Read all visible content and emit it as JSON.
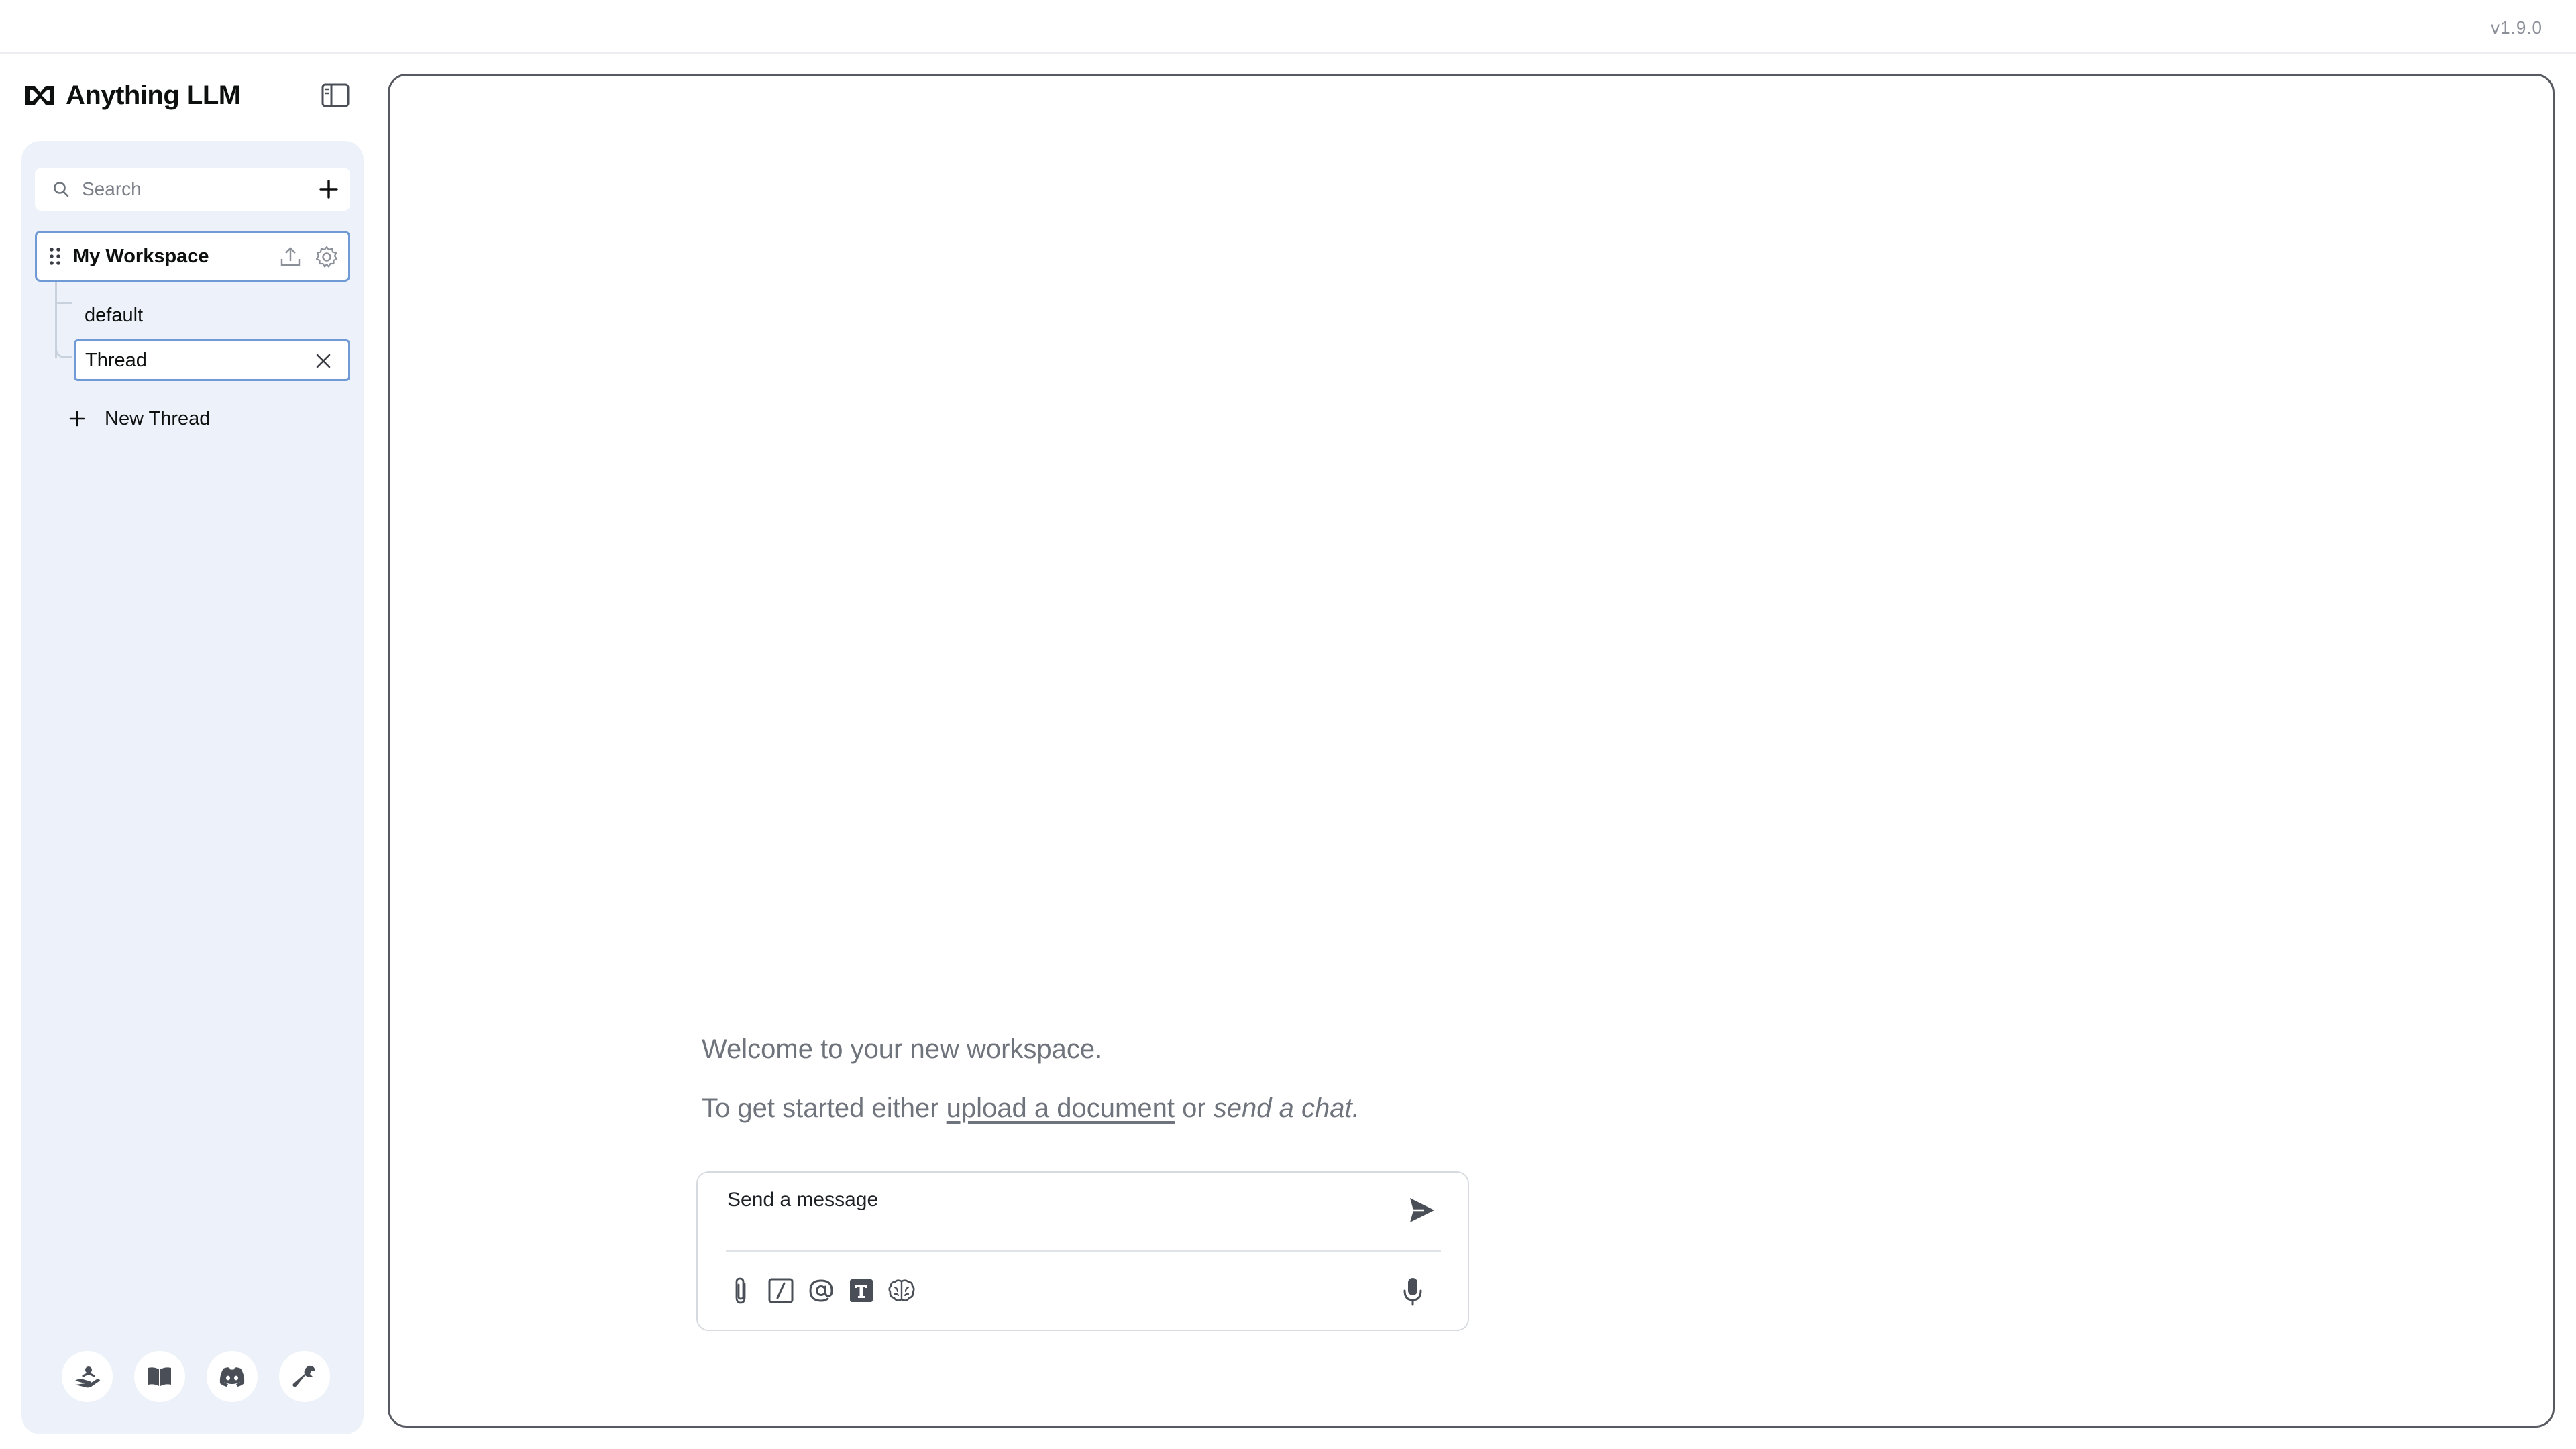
{
  "app": {
    "name": "Anything LLM",
    "version": "v1.9.0"
  },
  "sidebar": {
    "search": {
      "placeholder": "Search",
      "value": ""
    },
    "workspace": {
      "name": "My Workspace",
      "threads": [
        {
          "label": "default"
        }
      ],
      "editing_thread": {
        "value": "Thread"
      },
      "new_thread_label": "New Thread"
    },
    "footer_icons": [
      "community-hub-icon",
      "docs-book-icon",
      "discord-icon",
      "settings-wrench-icon"
    ]
  },
  "main": {
    "welcome": "Welcome to your new workspace.",
    "getstarted_prefix": "To get started either",
    "upload_link": "upload a document",
    "or_text": "or",
    "send_chat": "send a chat.",
    "composer": {
      "placeholder": "Send a message",
      "tools": [
        "attach-icon",
        "slash-command-icon",
        "at-mention-icon",
        "text-size-icon",
        "agent-brain-icon"
      ]
    }
  },
  "colors": {
    "sidebar_bg": "#edf2fa",
    "accent_border": "#6f9ad6",
    "text_muted": "#6f747c",
    "main_border": "#575b61"
  }
}
